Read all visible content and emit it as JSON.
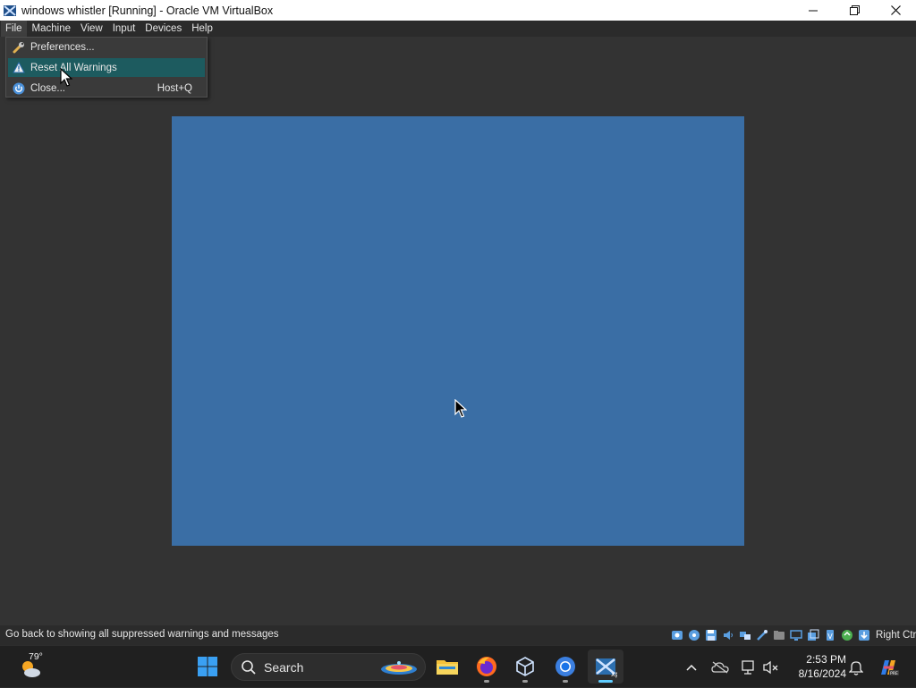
{
  "window": {
    "title": "windows whistler [Running] - Oracle VM VirtualBox",
    "controls": [
      "minimize-icon",
      "maximize-icon",
      "close-icon"
    ]
  },
  "menubar": {
    "items": [
      {
        "label": "File"
      },
      {
        "label": "Machine"
      },
      {
        "label": "View"
      },
      {
        "label": "Input"
      },
      {
        "label": "Devices"
      },
      {
        "label": "Help"
      }
    ]
  },
  "file_menu": {
    "items": [
      {
        "label": "Preferences...",
        "icon": "wrench-icon",
        "shortcut": ""
      },
      {
        "label": "Reset All Warnings",
        "icon": "warning-icon",
        "shortcut": ""
      },
      {
        "label": "Close...",
        "icon": "power-icon",
        "shortcut": "Host+Q"
      }
    ]
  },
  "vm": {
    "screen_color": "#3a6ea5"
  },
  "statusbar": {
    "message": "Go back to showing all suppressed warnings and messages",
    "host_key": "Right Ctrl",
    "icons": [
      "hard-disk-icon",
      "optical-drive-icon",
      "floppy-icon",
      "audio-icon",
      "network-icon",
      "usb-icon",
      "shared-folders-icon",
      "display-icon",
      "recording-icon",
      "cpu-icon",
      "mouse-integration-icon",
      "keyboard-icon"
    ]
  },
  "taskbar": {
    "weather_temp": "79°",
    "search_label": "Search",
    "time": "2:53 PM",
    "date": "8/16/2024",
    "apps": [
      "start-icon",
      "file-explorer-icon",
      "firefox-icon",
      "virtualbox-manager-icon",
      "chrome-icon",
      "virtualbox-vm-icon"
    ],
    "tray": [
      "chevron-up-icon",
      "onedrive-icon",
      "network-icon",
      "volume-muted-icon",
      "notification-bell-icon",
      "copilot-icon"
    ]
  },
  "colors": {
    "menu_highlight": "#1d5b5f",
    "accent": "#60cdff",
    "vm_background": "#333333"
  }
}
